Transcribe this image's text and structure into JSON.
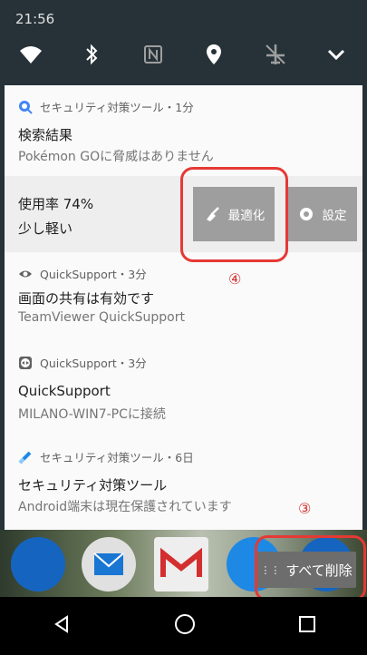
{
  "status_bar": {
    "time": "21:56"
  },
  "quick_settings": {
    "icons": [
      "wifi-icon",
      "bluetooth-icon",
      "nfc-icon",
      "location-icon",
      "airplane-mode-icon",
      "expand-chevron-icon"
    ]
  },
  "notifications": [
    {
      "app": "セキュリティ対策ツール・1分",
      "title": "検索結果",
      "text": "Pokémon GOに脅威はありません"
    },
    {
      "title": "使用率 74%",
      "text": "少し軽い",
      "actions": [
        "最適化",
        "設定"
      ]
    },
    {
      "app": "QuickSupport・3分",
      "title": "画面の共有は有効です",
      "text": "TeamViewer QuickSupport"
    },
    {
      "app": "QuickSupport・3分",
      "title": "QuickSupport",
      "text": "MILANO-WIN7-PCに接続"
    },
    {
      "app": "セキュリティ対策ツール・6日",
      "title": "セキュリティ対策ツール",
      "text": "Android端末は現在保護されています"
    }
  ],
  "clear_all_label": "すべて削除",
  "annotations": {
    "num_4": "④",
    "num_3": "③"
  },
  "colors": {
    "annotation": "#e53935",
    "button": "#9e9e9e",
    "status_bg": "#263238"
  }
}
